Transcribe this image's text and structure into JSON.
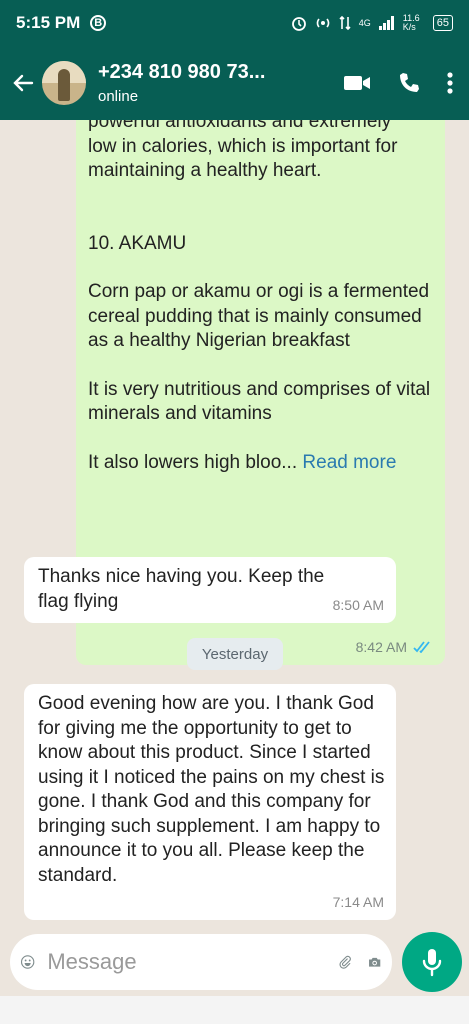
{
  "status_bar": {
    "time": "5:15 PM",
    "b_badge": "B",
    "network": "4G",
    "speed": "11.6 K/s",
    "battery": "65"
  },
  "header": {
    "contact_name": "+234 810 980 73...",
    "contact_status": "online",
    "icons": [
      "back-arrow-icon",
      "video-call-icon",
      "phone-icon",
      "more-vert-icon"
    ]
  },
  "messages": {
    "out1": {
      "lines": [
        "powerful antioxidants and extremely",
        "low in calories, which is important for",
        "maintaining a healthy heart.",
        "10. AKAMU",
        "Corn pap or akamu or ogi is a fermented cereal pudding that is mainly consumed as a healthy Nigerian breakfast",
        "It is very nutritious and comprises of vital minerals and vitamins",
        "It also lowers high bloo..."
      ],
      "read_more": "Read more",
      "time": "8:42 AM"
    },
    "in1": {
      "text": "Thanks nice having you. Keep the flag flying",
      "time": "8:50 AM"
    },
    "date_chip": "Yesterday",
    "in2": {
      "text": "Good evening how are you. I thank God for giving me the opportunity to get to know about this product. Since I started using it I noticed the pains on my chest is gone. I thank God and  this company for bringing such supplement. I am happy to announce it to you all. Please keep the standard.",
      "time": "7:14 AM"
    }
  },
  "composer": {
    "placeholder": "Message",
    "icons": [
      "emoji-icon",
      "attach-icon",
      "camera-icon",
      "mic-icon"
    ]
  },
  "colors": {
    "header": "#075e54",
    "outgoing_bubble": "#dcf8c6",
    "incoming_bubble": "#ffffff",
    "accent": "#00a884",
    "read_ticks": "#34b7f1"
  }
}
